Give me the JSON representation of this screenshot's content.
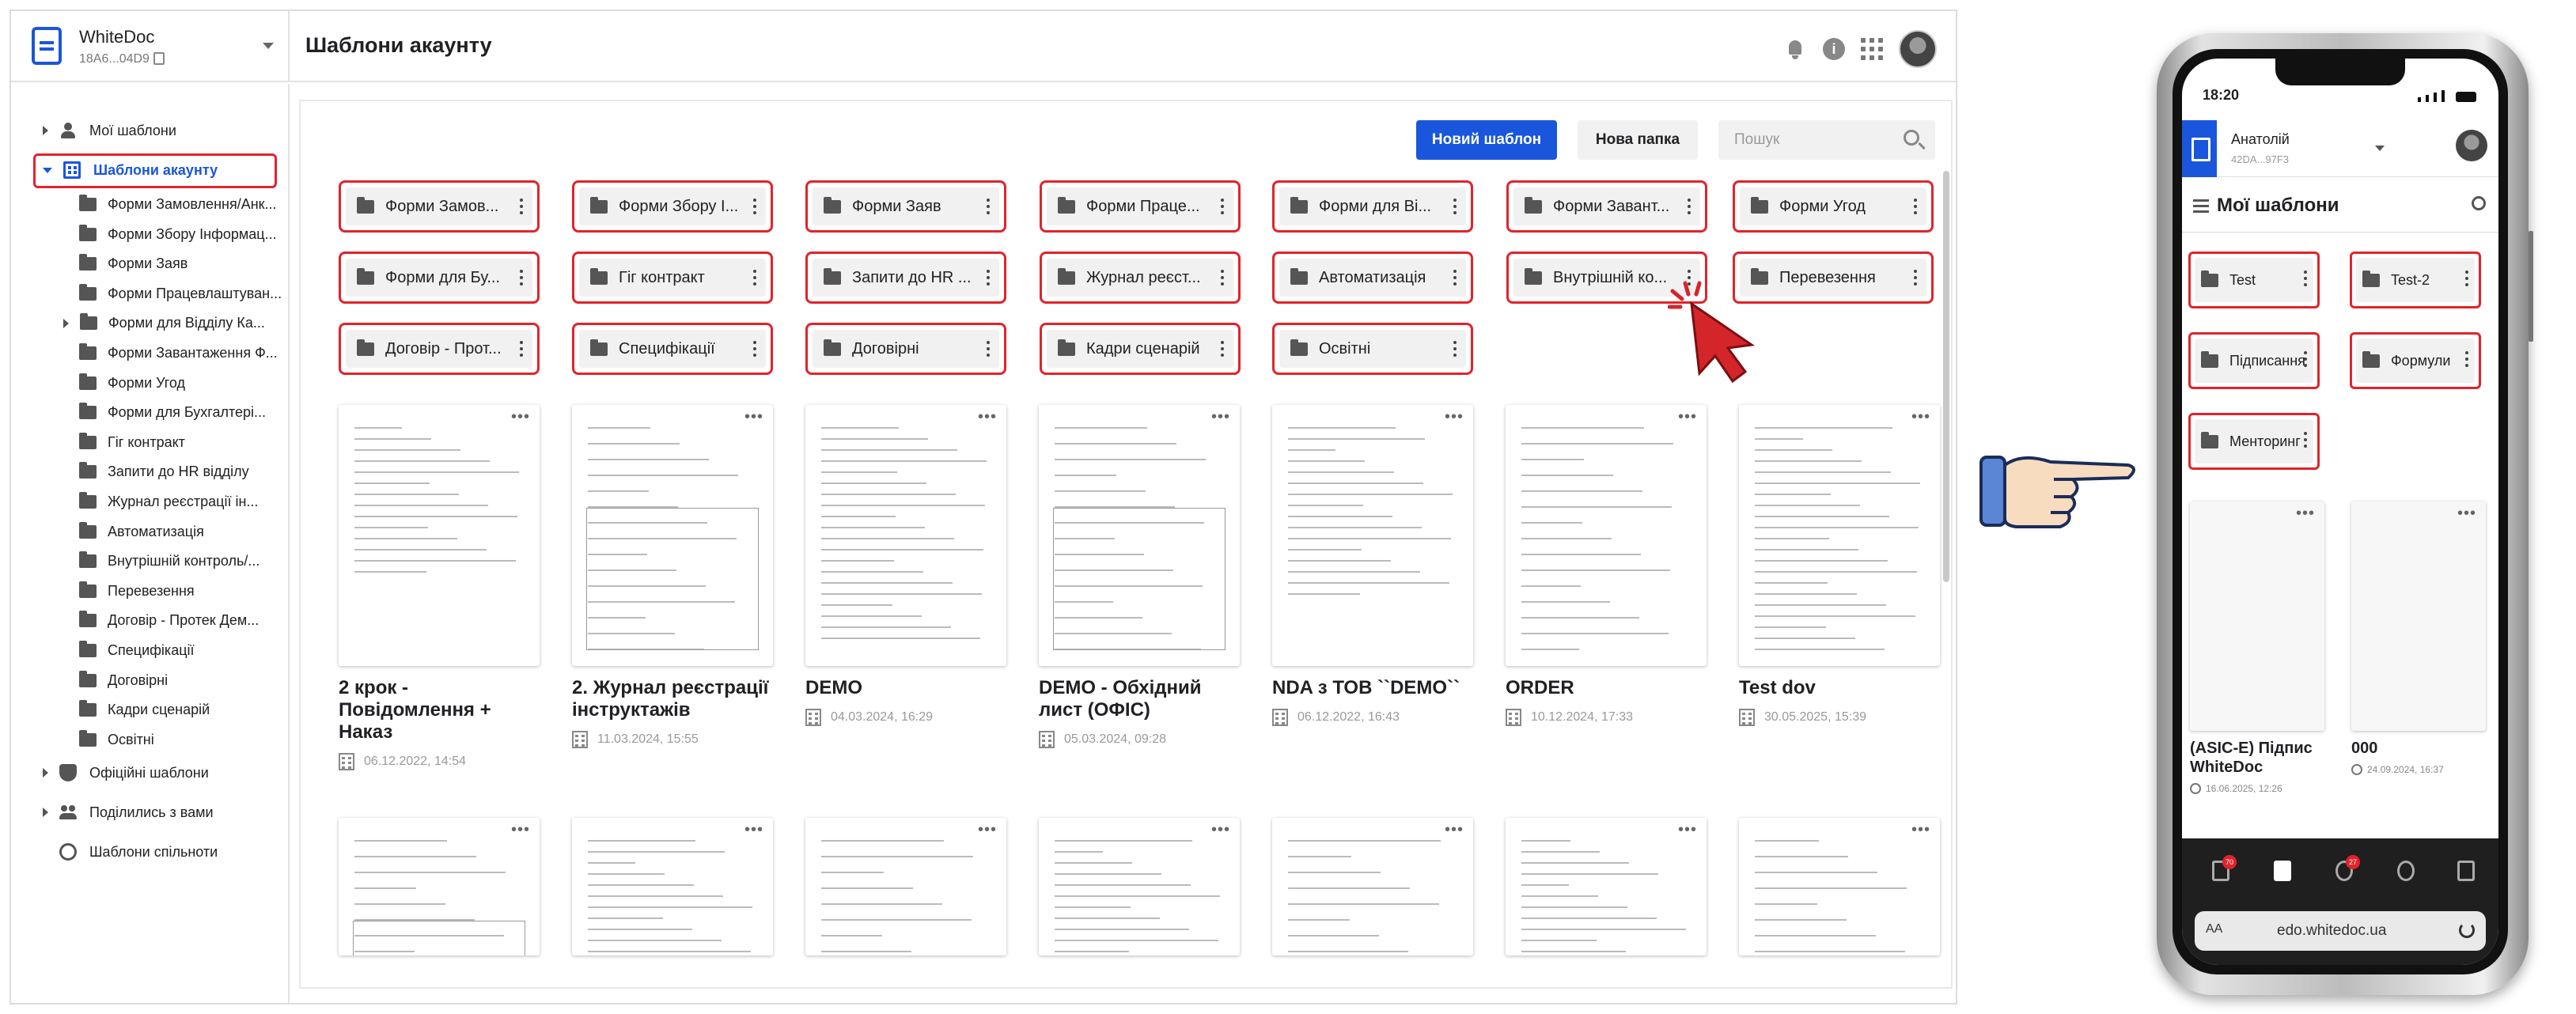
{
  "brand": {
    "name": "WhiteDoc",
    "account_id": "18A6...04D9"
  },
  "header": {
    "title": "Шаблони акаунту"
  },
  "sidebar": {
    "my_templates": "Мої шаблони",
    "account_templates": "Шаблони акаунту",
    "folders": [
      "Форми Замовлення/Анк...",
      "Форми Збору Інформац...",
      "Форми Заяв",
      "Форми Працевлаштуван...",
      "Форми для Відділу Ка...",
      "Форми Завантаження Ф...",
      "Форми Угод",
      "Форми для Бухгалтері...",
      "Гіг контракт",
      "Запити до HR відділу",
      "Журнал реєстрації ін...",
      "Автоматизація",
      "Внутрішній контроль/...",
      "Перевезення",
      "Договір - Протек Дем...",
      "Специфікації",
      "Договірні",
      "Кадри сценарій",
      "Освітні"
    ],
    "official_templates": "Офіційні шаблони",
    "shared_with_you": "Поділились з вами",
    "community_templates": "Шаблони спільноти"
  },
  "toolbar": {
    "new_template": "Новий шаблон",
    "new_folder": "Нова папка",
    "search_placeholder": "Пошук"
  },
  "folder_chips": [
    "Форми Замов...",
    "Форми Збору І...",
    "Форми Заяв",
    "Форми Праце...",
    "Форми для Ві...",
    "Форми Завант...",
    "Форми Угод",
    "Форми для Бу...",
    "Гіг контракт",
    "Запити до HR ...",
    "Журнал реєст...",
    "Автоматизація",
    "Внутрішній ко...",
    "Перевезення",
    "Договір - Прот...",
    "Специфікації",
    "Договірні",
    "Кадри сценарій",
    "Освітні"
  ],
  "templates": [
    {
      "name": "2 крок - Повідомлення + Наказ",
      "date": "06.12.2022, 14:54"
    },
    {
      "name": "2. Журнал реєстрації інструктажів",
      "date": "11.03.2024, 15:55"
    },
    {
      "name": "DEMO",
      "date": "04.03.2024, 16:29"
    },
    {
      "name": "DEMO - Обхідний лист (ОФІС)",
      "date": "05.03.2024, 09:28"
    },
    {
      "name": "NDA з ТОВ ``DEMO``",
      "date": "06.12.2022, 16:43"
    },
    {
      "name": "ORDER",
      "date": "10.12.2024, 17:33"
    },
    {
      "name": "Test dov",
      "date": "30.05.2025, 15:39"
    }
  ],
  "phone": {
    "time": "18:20",
    "user": "Анатолій",
    "account_id": "42DA...97F3",
    "title": "Мої шаблони",
    "folders": [
      "Test",
      "Test-2",
      "Підписання",
      "Формули",
      "Менторинг"
    ],
    "templates": [
      {
        "name": "(ASIC-E) Підпис WhiteDoc",
        "date": "16.06.2025, 12:26"
      },
      {
        "name": "000",
        "date": "24.09.2024, 16:37"
      }
    ],
    "badges": [
      "70",
      "27"
    ],
    "url": "edo.whitedoc.ua",
    "aa": "AA"
  },
  "colors": {
    "primary": "#1a56db",
    "highlight": "#e0242c"
  }
}
